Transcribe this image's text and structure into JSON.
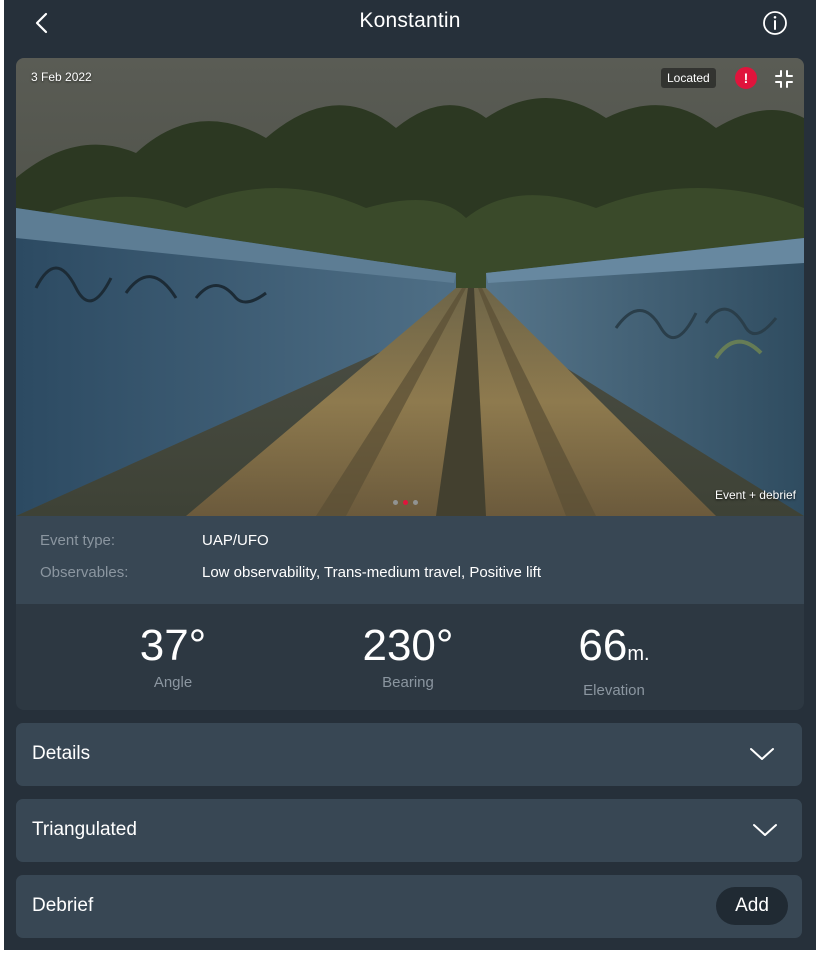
{
  "header": {
    "title": "Konstantin"
  },
  "icons": {
    "back": "chevron-left-icon",
    "info": "info-circle-icon",
    "alert": "alert-icon",
    "collapse": "collapse-icon",
    "chevron": "chevron-down-icon"
  },
  "photo": {
    "date": "3 Feb 2022",
    "status_badge": "Located",
    "alert_symbol": "!",
    "caption": "Event + debrief",
    "carousel": {
      "count": 3,
      "active_index": 1
    }
  },
  "meta": {
    "event_type_label": "Event type:",
    "event_type_value": "UAP/UFO",
    "observables_label": "Observables:",
    "observables_value": "Low observability, Trans-medium travel, Positive lift"
  },
  "stats": {
    "angle": {
      "value": "37°",
      "label": "Angle"
    },
    "bearing": {
      "value": "230°",
      "label": "Bearing"
    },
    "elevation": {
      "value": "66",
      "unit": "m.",
      "label": "Elevation"
    }
  },
  "sections": {
    "details": "Details",
    "triangulated": "Triangulated",
    "debrief": "Debrief",
    "add_label": "Add"
  },
  "colors": {
    "background": "#26303a",
    "panel": "#384754",
    "accent": "#e0143c",
    "muted_text": "#8b96a0"
  }
}
